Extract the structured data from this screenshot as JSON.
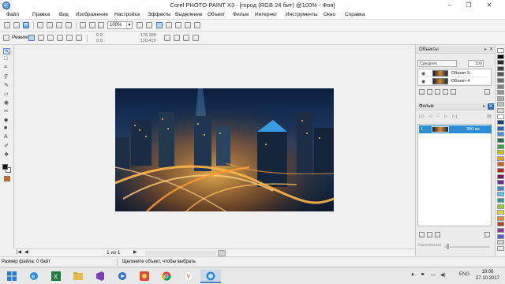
{
  "window": {
    "title": "Corel PHOTO-PAINT X3 - [город (RGB 24 бит) @100% - Фон]",
    "min_label": "–",
    "max_label": "❐",
    "close_label": "✕"
  },
  "menu": [
    "Файл",
    "Правка",
    "Вид",
    "Изображение",
    "Настройка",
    "Эффекты",
    "Выделение",
    "Объект",
    "Фильм",
    "Интернет",
    "Инструменты",
    "Окно",
    "Справка"
  ],
  "toolbar": {
    "zoom_value": "100%",
    "mode_label": "Режим",
    "fields": [
      "0.0",
      "0.0",
      "176.389",
      "110.419"
    ]
  },
  "objects_panel": {
    "title": "Объекты",
    "blend_mode": "Среднее",
    "opacity": "100",
    "items": [
      "Объект 5",
      "Объект 4"
    ]
  },
  "film_panel": {
    "title": "Фильм",
    "frames": [
      {
        "number": "1",
        "duration": "300 мс"
      }
    ],
    "blend_label": "Наложение:"
  },
  "canvas": {
    "page_label": "1 из 1"
  },
  "status": {
    "file_size": "Размер файла: 0 байт",
    "hint": "Щелкните объект, чтобы выбрать"
  },
  "palette_colors": [
    "#ffffff",
    "#000000",
    "#2b2b2b",
    "#404040",
    "#555555",
    "#6b6b6b",
    "#808080",
    "#959595",
    "#aaaaaa",
    "#bfbfbf",
    "#d5d5d5",
    "#ffffff",
    "#1e3f7a",
    "#2e62b8",
    "#4a90d9",
    "#1e7a3a",
    "#3aa043",
    "#c9c219",
    "#e4a21c",
    "#d65a1a",
    "#c41f1f",
    "#7a1a5a",
    "#6a2d8c",
    "#3a8ac9",
    "#5fc2e6",
    "#2aa08a",
    "#a2c13a",
    "#e6d24a",
    "#e68a3a",
    "#b03a2e",
    "#8a3a9a",
    "#5a5ac9",
    "#d0d0d0",
    "#e8e8e8"
  ],
  "taskbar": {
    "lang": "ENG",
    "time": "19:06",
    "date": "27.10.2017"
  }
}
